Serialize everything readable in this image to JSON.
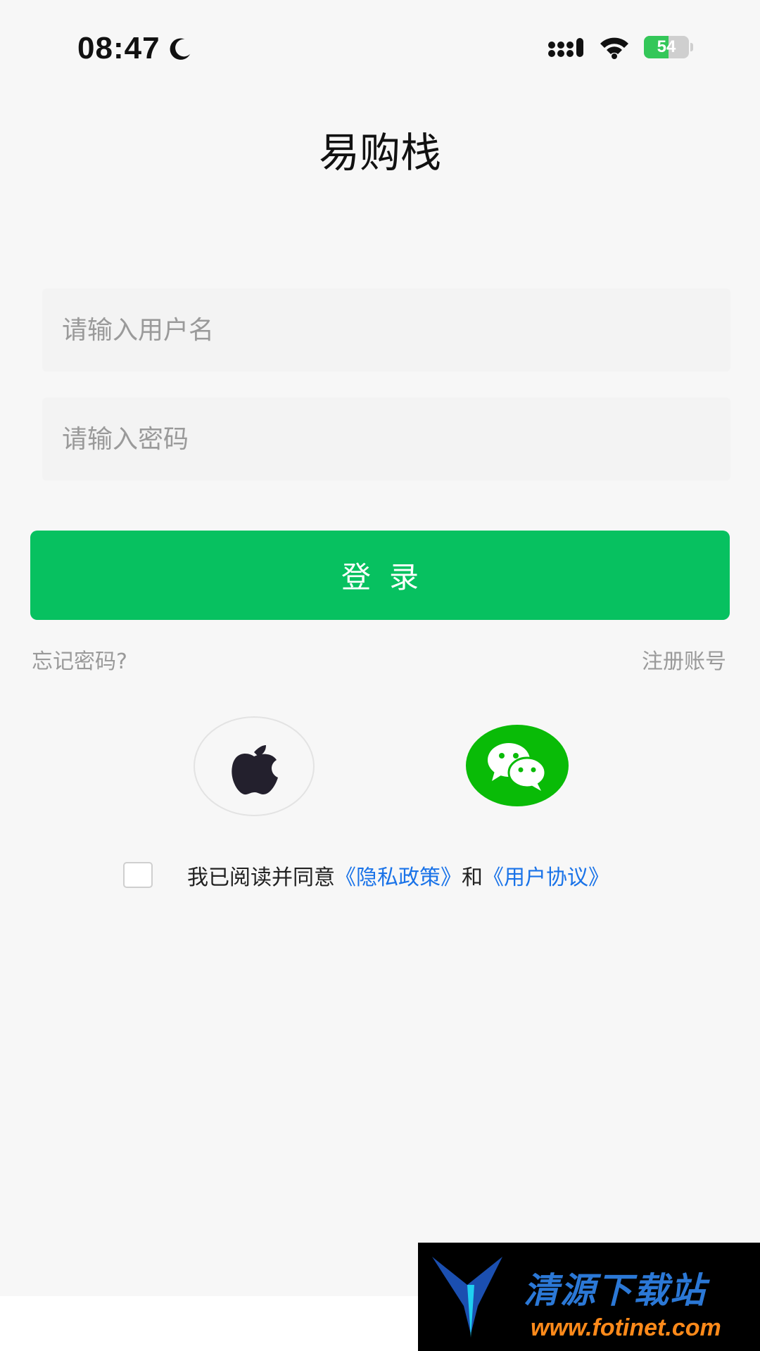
{
  "status_bar": {
    "time": "08:47",
    "battery_level": "54",
    "icons": [
      "moon-icon",
      "signal-icon",
      "wifi-icon",
      "battery-icon"
    ]
  },
  "app": {
    "title": "易购栈"
  },
  "form": {
    "username_placeholder": "请输入用户名",
    "password_placeholder": "请输入密码",
    "login_label": "登录",
    "forgot_password": "忘记密码?",
    "register": "注册账号"
  },
  "social": {
    "apple_icon": "apple-icon",
    "wechat_icon": "wechat-icon",
    "wechat_color": "#09bb07"
  },
  "agreement": {
    "prefix": "我已阅读并同意",
    "privacy": "《隐私政策》",
    "and": "和",
    "terms": "《用户协议》"
  },
  "watermark": {
    "text": "清源下载站",
    "url": "www.fotinet.com"
  },
  "colors": {
    "primary": "#07c160",
    "link": "#1a73e8",
    "background": "#f7f7f7"
  }
}
